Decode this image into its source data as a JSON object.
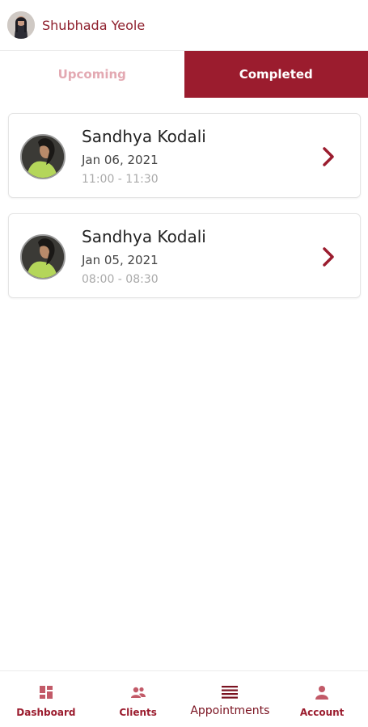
{
  "header": {
    "user_name": "Shubhada Yeole"
  },
  "tabs": [
    {
      "label": "Upcoming",
      "active": false
    },
    {
      "label": "Completed",
      "active": true
    }
  ],
  "appointments": [
    {
      "client_name": "Sandhya Kodali",
      "date": "Jan 06, 2021",
      "time": "11:00 - 11:30"
    },
    {
      "client_name": "Sandhya Kodali",
      "date": "Jan 05, 2021",
      "time": "08:00 - 08:30"
    }
  ],
  "bottom_nav": [
    {
      "label": "Dashboard",
      "icon": "dashboard-icon"
    },
    {
      "label": "Clients",
      "icon": "clients-icon"
    },
    {
      "label": "Appointments",
      "icon": "appointments-icon"
    },
    {
      "label": "Account",
      "icon": "account-icon"
    }
  ],
  "colors": {
    "brand": "#9b1c2e",
    "tab_inactive_text": "#e3a9b2",
    "time_text": "#aaaaaa"
  }
}
